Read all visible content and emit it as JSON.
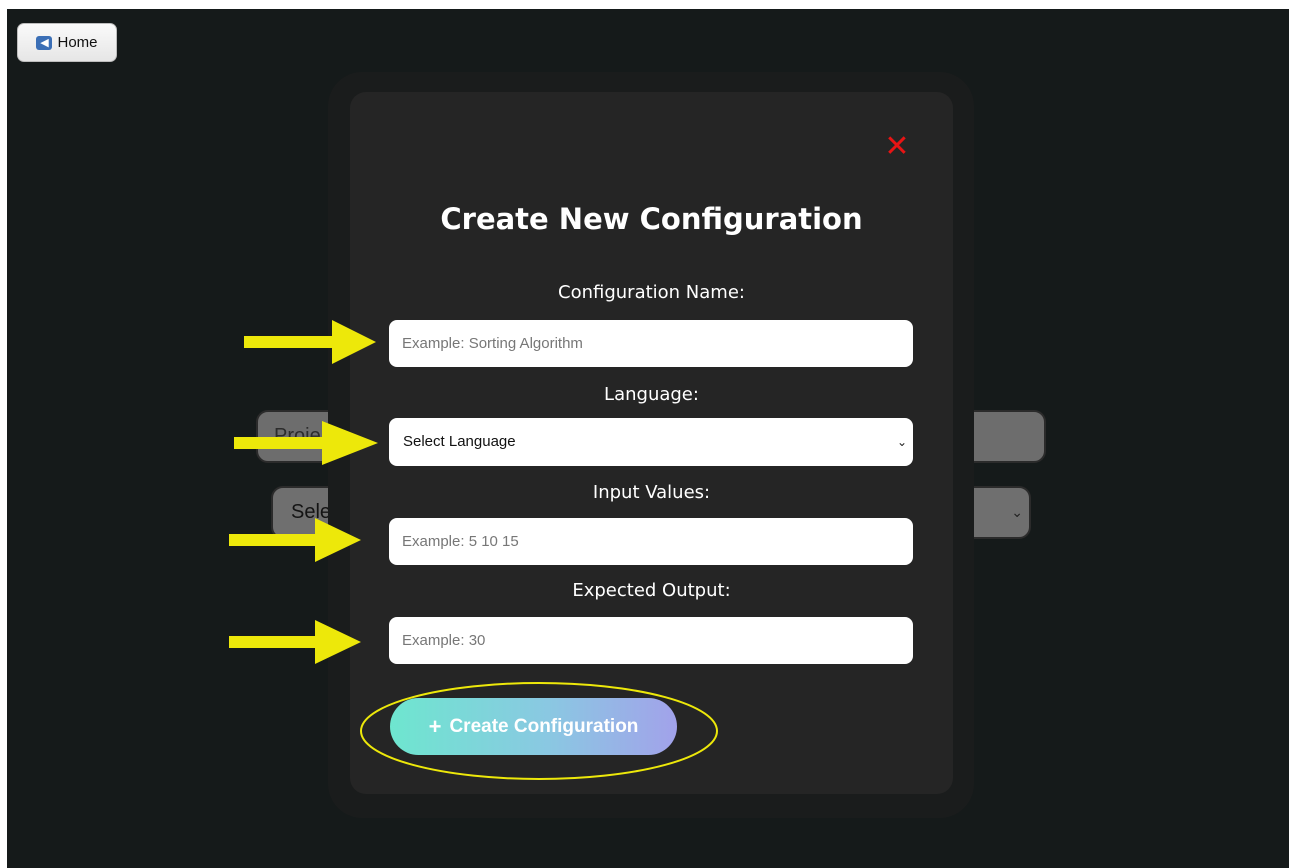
{
  "home_button": {
    "label": "Home",
    "icon": "back-arrow-icon"
  },
  "background_form": {
    "project_input_value": "Proje",
    "select_value": "Select"
  },
  "modal": {
    "title": "Create New Configuration",
    "close_icon": "✕",
    "fields": {
      "config_name": {
        "label": "Configuration Name:",
        "placeholder": "Example: Sorting Algorithm"
      },
      "language": {
        "label": "Language:",
        "selected": "Select Language"
      },
      "input_values": {
        "label": "Input Values:",
        "placeholder": "Example: 5 10 15"
      },
      "expected_output": {
        "label": "Expected Output:",
        "placeholder": "Example: 30"
      }
    },
    "create_button": {
      "label": "Create Configuration",
      "icon": "+"
    }
  },
  "colors": {
    "page_bg": "#151a1a",
    "modal_bg": "#252525",
    "close_red": "#e81414",
    "annotation_yellow": "#ede80a",
    "button_gradient_start": "#6ee6cf",
    "button_gradient_end": "#a2a2ea"
  }
}
